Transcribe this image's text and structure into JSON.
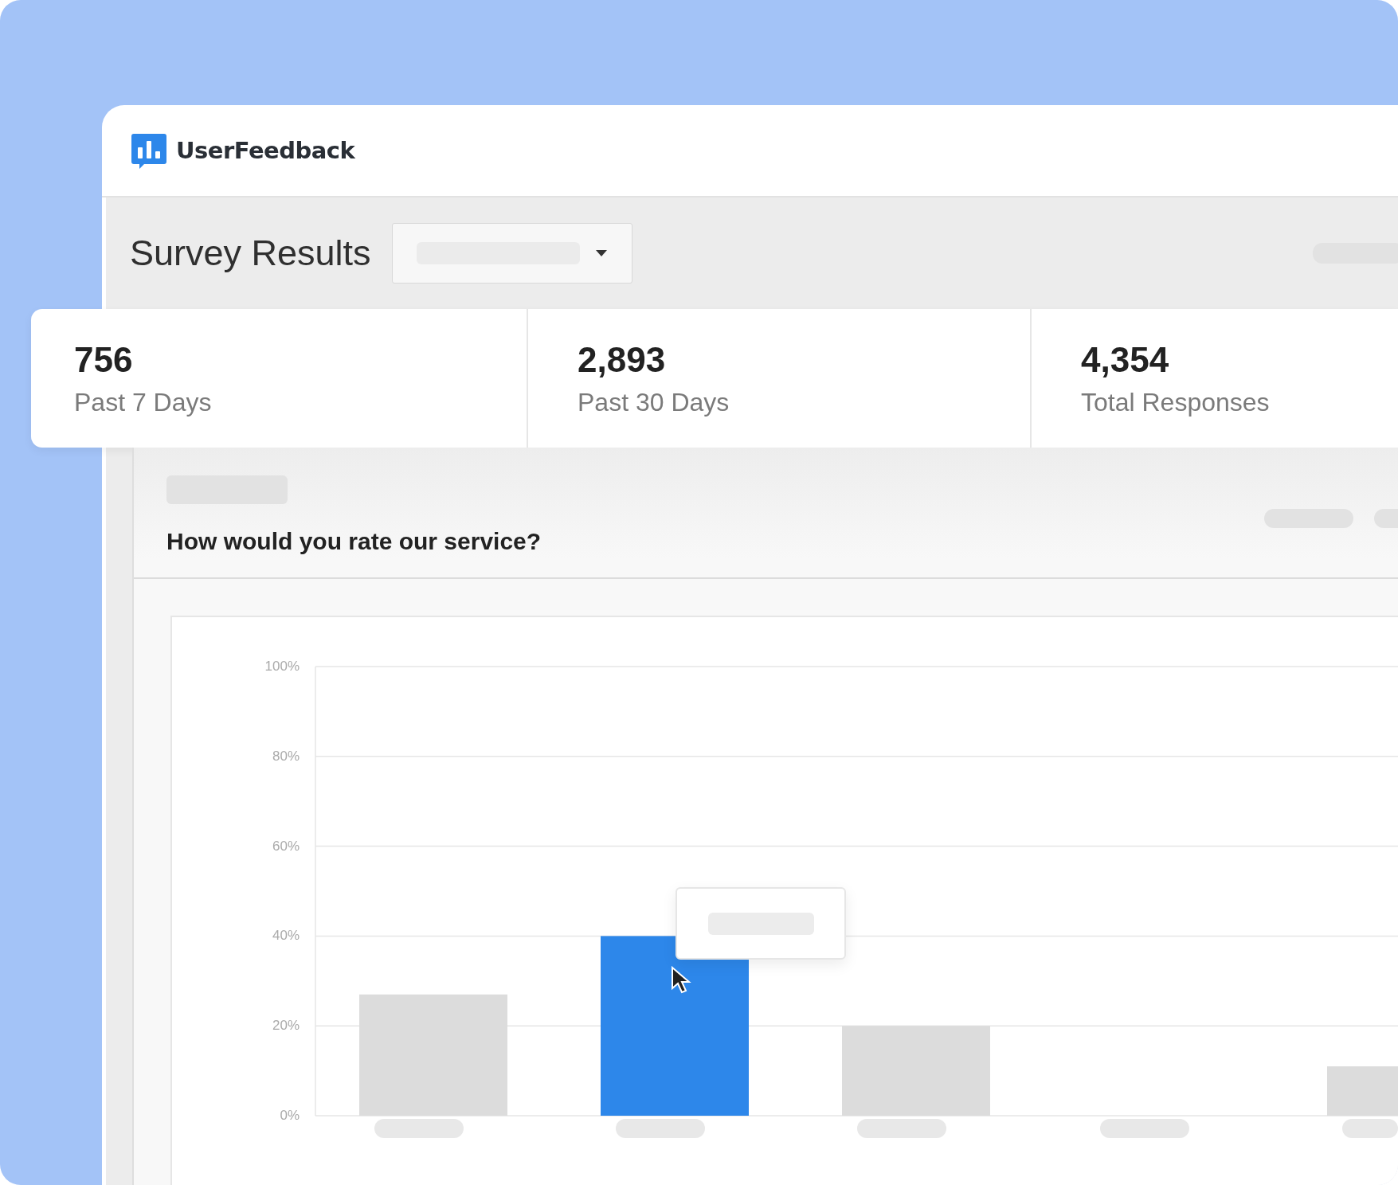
{
  "header": {
    "brand": "UserFeedback"
  },
  "toolbar": {
    "title": "Survey Results"
  },
  "stats": [
    {
      "value": "756",
      "label": "Past 7 Days"
    },
    {
      "value": "2,893",
      "label": "Past 30 Days"
    },
    {
      "value": "4,354",
      "label": "Total Responses"
    }
  ],
  "question": {
    "text": "How would you rate our service?",
    "bars": [
      {
        "highlighted": false
      },
      {
        "highlighted": true
      },
      {
        "highlighted": false
      },
      {
        "highlighted": false
      },
      {
        "highlighted": false
      }
    ],
    "chart_data": {
      "type": "bar",
      "grid": true,
      "ylim": [
        0,
        100
      ],
      "values": [
        27,
        40,
        20,
        0,
        11
      ],
      "yticks": [
        {
          "value": 0,
          "label": "0%"
        },
        {
          "value": 20,
          "label": "20%"
        },
        {
          "value": 40,
          "label": "40%"
        },
        {
          "value": 60,
          "label": "60%"
        },
        {
          "value": 80,
          "label": "80%"
        },
        {
          "value": 100,
          "label": "100%"
        }
      ]
    }
  }
}
